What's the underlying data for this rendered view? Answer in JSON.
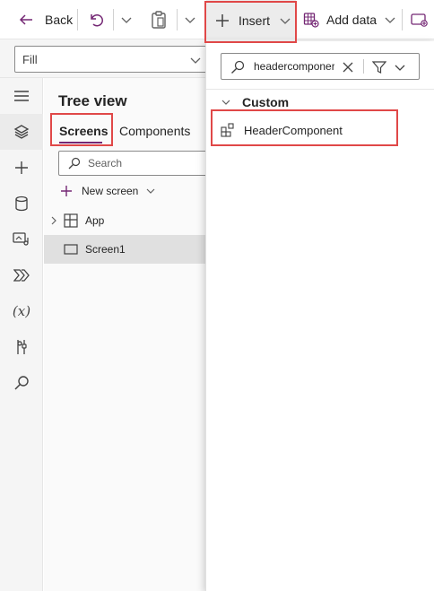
{
  "toolbar": {
    "back_label": "Back",
    "insert_label": "Insert",
    "add_data_label": "Add data"
  },
  "formula_bar": {
    "property_value": "Fill"
  },
  "tree_view": {
    "title": "Tree view",
    "tabs": [
      {
        "label": "Screens",
        "active": true
      },
      {
        "label": "Components",
        "active": false
      }
    ],
    "search_placeholder": "Search",
    "new_screen_label": "New screen",
    "items": [
      {
        "label": "App",
        "icon": "app-tree-icon",
        "selected": false
      },
      {
        "label": "Screen1",
        "icon": "screen-icon",
        "selected": true
      }
    ]
  },
  "insert_panel": {
    "search_value": "headercomponer",
    "section_title": "Custom",
    "results": [
      {
        "label": "HeaderComponent",
        "icon": "component-icon"
      }
    ]
  },
  "rail": {
    "icons": [
      "hamburger-icon",
      "tree-view-icon",
      "insert-icon",
      "data-icon",
      "media-icon",
      "power-automate-icon",
      "variables-icon",
      "advanced-tools-icon",
      "search-icon"
    ]
  },
  "colors": {
    "accent": "#742774",
    "highlight": "#e04848"
  }
}
